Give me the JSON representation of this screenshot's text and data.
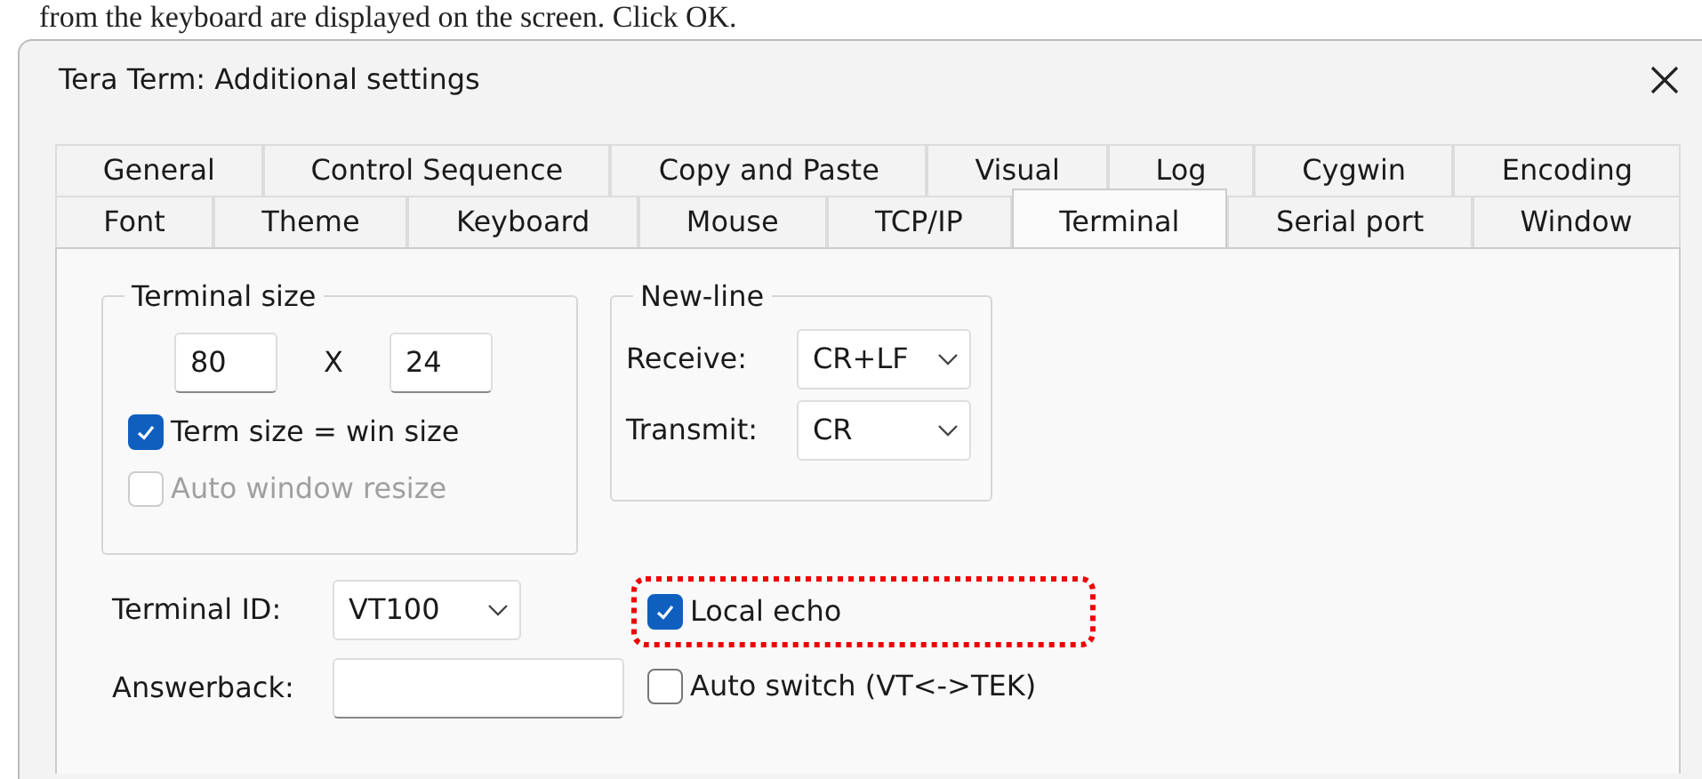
{
  "caption": "from the keyboard are displayed on the screen. Click OK.",
  "window": {
    "title": "Tera Term: Additional settings"
  },
  "tab_rows": [
    [
      {
        "label": "General",
        "selected": false
      },
      {
        "label": "Control Sequence",
        "selected": false
      },
      {
        "label": "Copy and Paste",
        "selected": false
      },
      {
        "label": "Visual",
        "selected": false
      },
      {
        "label": "Log",
        "selected": false
      },
      {
        "label": "Cygwin",
        "selected": false
      },
      {
        "label": "Encoding",
        "selected": false
      }
    ],
    [
      {
        "label": "Font",
        "selected": false
      },
      {
        "label": "Theme",
        "selected": false
      },
      {
        "label": "Keyboard",
        "selected": false
      },
      {
        "label": "Mouse",
        "selected": false
      },
      {
        "label": "TCP/IP",
        "selected": false
      },
      {
        "label": "Terminal",
        "selected": true
      },
      {
        "label": "Serial port",
        "selected": false
      },
      {
        "label": "Window",
        "selected": false
      }
    ]
  ],
  "terminal_size": {
    "label": "Terminal size",
    "columns": "80",
    "separator": "X",
    "rows": "24",
    "checkboxes": [
      {
        "label": "Term size = win size",
        "checked": true,
        "disabled": false
      },
      {
        "label": "Auto window resize",
        "checked": false,
        "disabled": true
      }
    ]
  },
  "new_line": {
    "label": "New-line",
    "fields": [
      {
        "label": "Receive:",
        "value": "CR+LF"
      },
      {
        "label": "Transmit:",
        "value": "CR"
      }
    ]
  },
  "terminal_id": {
    "label": "Terminal ID:",
    "value": "VT100"
  },
  "answerback": {
    "label": "Answerback:"
  },
  "options": [
    {
      "label": "Local echo",
      "checked": true,
      "highlighted": true
    },
    {
      "label": "Auto switch (VT<->TEK)",
      "checked": false,
      "highlighted": false
    }
  ]
}
